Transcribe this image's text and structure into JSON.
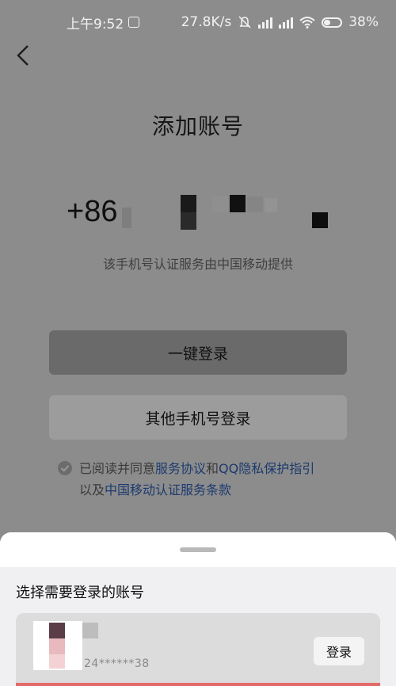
{
  "status_bar": {
    "time": "上午9:52",
    "net_speed": "27.8K/s",
    "battery": "38%",
    "icons": [
      "app-badge-icon",
      "mute-icon",
      "signal-icon",
      "signal-icon",
      "wifi-icon",
      "battery-icon"
    ]
  },
  "header": {
    "back_icon": "chevron-left-icon"
  },
  "title": "添加账号",
  "phone": {
    "country_code": "+86"
  },
  "provider_note": "该手机号认证服务由中国移动提供",
  "buttons": {
    "one_click_login": "一键登录",
    "other_phone_login": "其他手机号登录"
  },
  "agreement": {
    "prefix": "已阅读并同意",
    "link1": "服务协议",
    "and": "和",
    "link2": "QQ隐私保护指引",
    "prefix2": "以及",
    "link3": "中国移动认证服务条款"
  },
  "sheet": {
    "title": "选择需要登录的账号",
    "account_masked": "24******38",
    "login_label": "登录"
  },
  "colors": {
    "link": "#1c3a6e",
    "overlay": "#8c8c8c",
    "sheet_bg": "#ffffff"
  }
}
